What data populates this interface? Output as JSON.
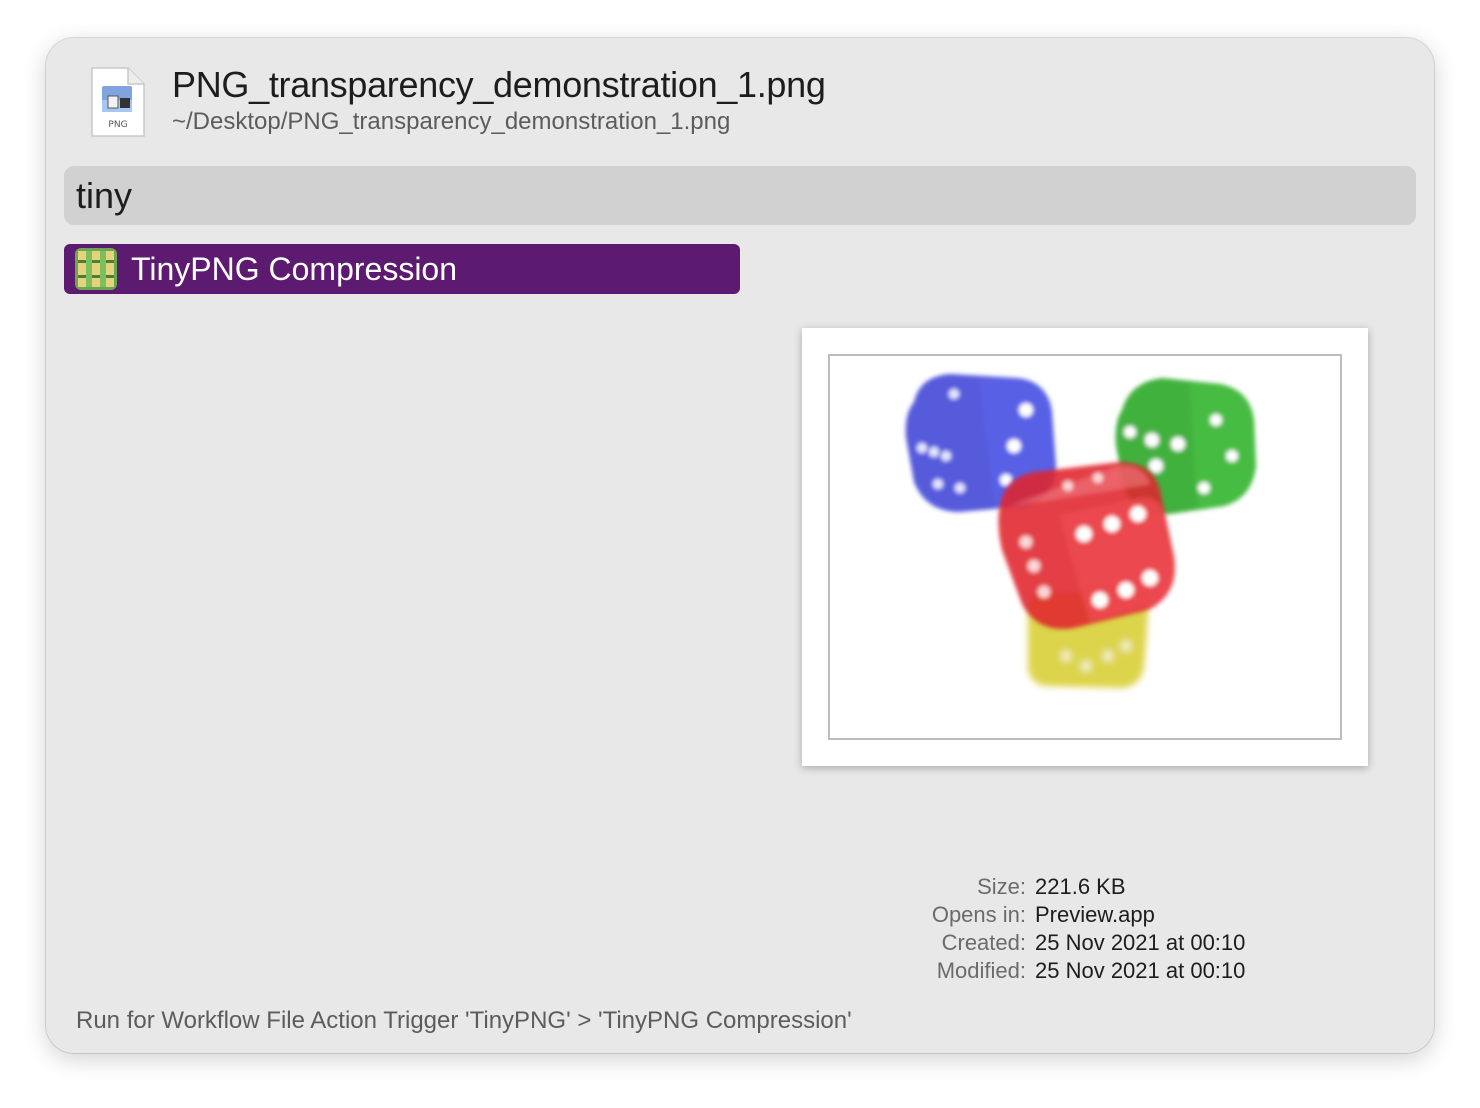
{
  "file": {
    "name": "PNG_transparency_demonstration_1.png",
    "path": "~/Desktop/PNG_transparency_demonstration_1.png",
    "icon_label": "PNG",
    "icon": "png-file-icon"
  },
  "search": {
    "value": "tiny"
  },
  "results": [
    {
      "label": "TinyPNG Compression",
      "icon": "tinypng-workflow-icon",
      "selected": true
    }
  ],
  "preview": {
    "icon": "dice-image-thumbnail"
  },
  "metadata": [
    {
      "key": "Size:",
      "value": "221.6 KB"
    },
    {
      "key": "Opens in:",
      "value": "Preview.app"
    },
    {
      "key": "Created:",
      "value": "25 Nov 2021 at 00:10"
    },
    {
      "key": "Modified:",
      "value": "25 Nov 2021 at 00:10"
    }
  ],
  "footer": {
    "text": "Run for Workflow File Action Trigger 'TinyPNG' > 'TinyPNG Compression'"
  },
  "colors": {
    "selection": "#5c1a70",
    "window_bg": "#e8e8e8",
    "search_bg": "#d1d1d1"
  }
}
